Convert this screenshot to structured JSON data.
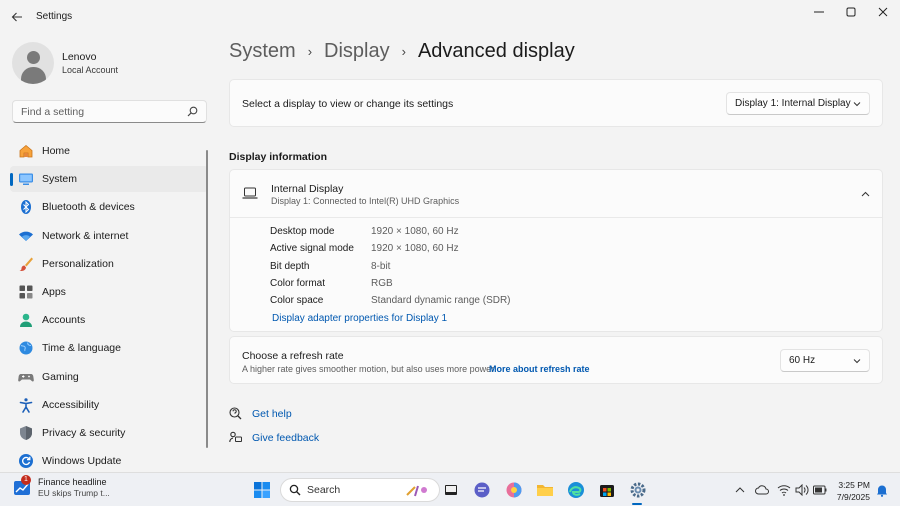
{
  "window": {
    "title": "Settings"
  },
  "profile": {
    "name": "Lenovo",
    "account_type": "Local Account"
  },
  "search": {
    "placeholder": "Find a setting"
  },
  "sidebar": {
    "items": [
      {
        "label": "Home",
        "icon": "home-icon",
        "active": false
      },
      {
        "label": "System",
        "icon": "system-icon",
        "active": true
      },
      {
        "label": "Bluetooth & devices",
        "icon": "bluetooth-icon",
        "active": false
      },
      {
        "label": "Network & internet",
        "icon": "wifi-icon",
        "active": false
      },
      {
        "label": "Personalization",
        "icon": "brush-icon",
        "active": false
      },
      {
        "label": "Apps",
        "icon": "apps-icon",
        "active": false
      },
      {
        "label": "Accounts",
        "icon": "accounts-icon",
        "active": false
      },
      {
        "label": "Time & language",
        "icon": "globe-icon",
        "active": false
      },
      {
        "label": "Gaming",
        "icon": "gamepad-icon",
        "active": false
      },
      {
        "label": "Accessibility",
        "icon": "accessibility-icon",
        "active": false
      },
      {
        "label": "Privacy & security",
        "icon": "shield-icon",
        "active": false
      },
      {
        "label": "Windows Update",
        "icon": "update-icon",
        "active": false
      }
    ]
  },
  "breadcrumb": {
    "items": [
      "System",
      "Display",
      "Advanced display"
    ]
  },
  "select_display": {
    "label": "Select a display to view or change its settings",
    "value": "Display 1: Internal Display"
  },
  "display_info": {
    "section_title": "Display information",
    "display_name": "Internal Display",
    "display_sub": "Display 1: Connected to Intel(R) UHD Graphics",
    "rows": [
      {
        "key": "Desktop mode",
        "value": "1920 × 1080, 60 Hz"
      },
      {
        "key": "Active signal mode",
        "value": "1920 × 1080, 60 Hz"
      },
      {
        "key": "Bit depth",
        "value": "8-bit"
      },
      {
        "key": "Color format",
        "value": "RGB"
      },
      {
        "key": "Color space",
        "value": "Standard dynamic range (SDR)"
      }
    ],
    "adapter_link": "Display adapter properties for Display 1"
  },
  "refresh_rate": {
    "title": "Choose a refresh rate",
    "description": "A higher rate gives smoother motion, but also uses more power",
    "more_link": "More about refresh rate",
    "value": "60 Hz"
  },
  "help": {
    "get_help": "Get help",
    "give_feedback": "Give feedback"
  },
  "taskbar": {
    "widget_badge": "1",
    "widget_title": "Finance headline",
    "widget_sub": "EU skips Trump t...",
    "search_label": "Search",
    "time": "3:25 PM",
    "date": "7/9/2025"
  },
  "colors": {
    "accent": "#0067c0",
    "link": "#0058b0",
    "background": "#f3f3f3",
    "card": "#fbfbfb"
  }
}
